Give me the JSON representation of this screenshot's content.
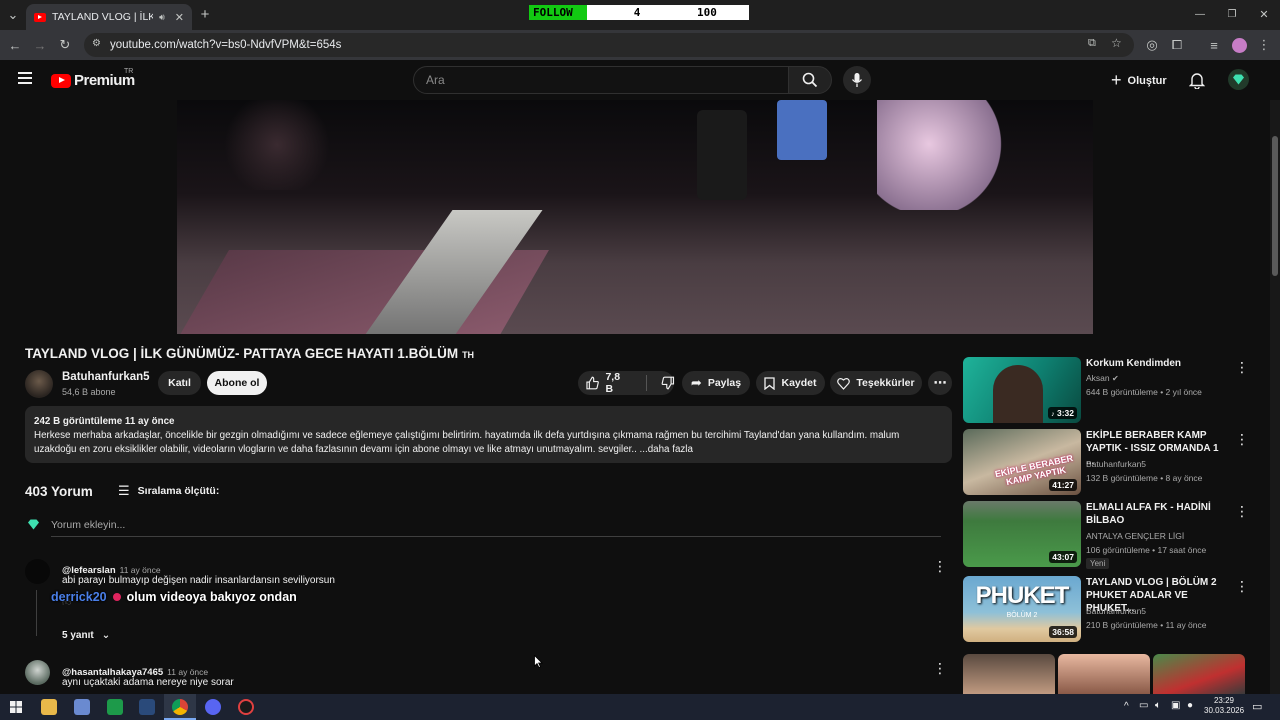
{
  "browser": {
    "tab_title": "TAYLAND VLOG | İLK GÜNÜMÜ",
    "url": "youtube.com/watch?v=bs0-NdvfVPM&t=654s"
  },
  "overlay": {
    "follow_label": "FOLLOW",
    "follow_current": "4",
    "follow_goal": "100"
  },
  "header": {
    "logo_text": "Premium",
    "country": "TR",
    "search_placeholder": "Ara",
    "create_label": "Oluştur"
  },
  "video": {
    "title": "TAYLAND VLOG | İLK GÜNÜMÜZ- PATTAYA GECE HAYATI 1.BÖLÜM",
    "title_suffix": "TH",
    "channel": "Batuhanfurkan5",
    "subscribers": "54,6 B abone",
    "join_label": "Katıl",
    "subscribe_label": "Abone ol",
    "likes": "7,8 B",
    "share_label": "Paylaş",
    "save_label": "Kaydet",
    "thanks_label": "Teşekkürler"
  },
  "description": {
    "stats": "242 B görüntüleme  11 ay önce",
    "text": "Herkese merhaba arkadaşlar, öncelikle bir gezgin olmadığımı ve sadece eğlemeye çalıştığımı belirtirim. hayatımda ilk defa yurtdışına çıkmama rağmen bu tercihimi Tayland'dan yana kullandım. malum uzakdoğu en zoru eksiklikler olabilir, videoların vlogların ve daha fazlasının devamı için abone olmayı ve like atmayı unutmayalım. sevgiler.. ...daha fazla"
  },
  "comments": {
    "count_label": "403 Yorum",
    "sort_label": "Sıralama ölçütü:",
    "add_placeholder": "Yorum ekleyin...",
    "items": [
      {
        "author": "@lefearslan",
        "time": "11 ay önce",
        "text": "abi parayı bulmayıp değişen nadir insanlardansın seviliyorsun",
        "replies": "5 yanıt"
      },
      {
        "author": "@hasantalhakaya7465",
        "time": "11 ay önce",
        "text": "aynı uçaktaki adama nereye niye sorar"
      }
    ]
  },
  "chat_overlay": {
    "user": "derrick20",
    "message": "olum videoya bakıyoz ondan"
  },
  "related": [
    {
      "title": "Korkum Kendimden",
      "channel": "Aksan",
      "meta": "644 B görüntüleme • 2 yıl önce",
      "duration": "3:32"
    },
    {
      "title": "EKİPLE BERABER KAMP YAPTIK - ISSIZ ORMANDA 1 ...",
      "channel": "Batuhanfurkan5",
      "meta": "132 B görüntüleme • 8 ay önce",
      "duration": "41:27",
      "thumb_text": "EKİPLE BERABER KAMP YAPTIK"
    },
    {
      "title": "ELMALI ALFA FK - HADİNİ BİLBAO",
      "channel": "ANTALYA GENÇLER LİGİ",
      "meta": "106 görüntüleme • 17 saat önce",
      "duration": "43:07",
      "badge": "Yeni"
    },
    {
      "title": "TAYLAND VLOG | BÖLÜM 2 PHUKET ADALAR VE PHUKET...",
      "channel": "Batuhanfurkan5",
      "meta": "210 B görüntüleme • 11 ay önce",
      "duration": "36:58",
      "thumb_text": "PHUKET",
      "thumb_sub": "BÖLÜM 2"
    }
  ],
  "taskbar": {
    "time": "23:29",
    "date": "30.03.2026"
  },
  "colors": {
    "background": "#0f0f0f",
    "youtube_red": "#ff0000",
    "follow_green": "#12c912"
  }
}
